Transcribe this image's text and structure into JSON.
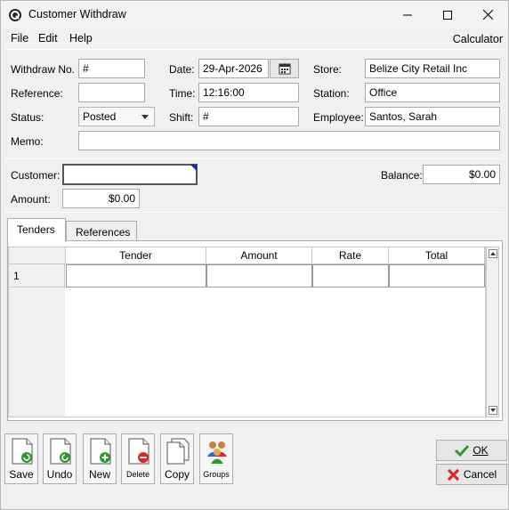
{
  "window": {
    "title": "Customer Withdraw"
  },
  "menu": {
    "file": "File",
    "edit": "Edit",
    "help": "Help",
    "calculator": "Calculator"
  },
  "header": {
    "withdraw_no_label": "Withdraw No.",
    "withdraw_no_value": "#",
    "reference_label": "Reference:",
    "reference_value": "",
    "status_label": "Status:",
    "status_value": "Posted",
    "memo_label": "Memo:",
    "memo_value": "",
    "date_label": "Date:",
    "date_value": "29-Apr-2026",
    "time_label": "Time:",
    "time_value": "12:16:00",
    "shift_label": "Shift:",
    "shift_value": "#",
    "store_label": "Store:",
    "store_value": "Belize City Retail Inc",
    "station_label": "Station:",
    "station_value": "Office",
    "employee_label": "Employee:",
    "employee_value": "Santos, Sarah"
  },
  "customer": {
    "customer_label": "Customer:",
    "customer_value": "",
    "amount_label": "Amount:",
    "amount_value": "$0.00",
    "balance_label": "Balance:",
    "balance_value": "$0.00"
  },
  "tabs": [
    {
      "label": "Tenders"
    },
    {
      "label": "References"
    }
  ],
  "grid": {
    "columns": [
      "Tender",
      "Amount",
      "Rate",
      "Total"
    ],
    "rows": [
      {
        "num": "1",
        "tender": "",
        "amount": "",
        "rate": "",
        "total": ""
      }
    ]
  },
  "toolbar": {
    "save": "Save",
    "undo": "Undo",
    "new": "New",
    "delete": "Delete",
    "copy": "Copy",
    "groups": "Groups"
  },
  "actions": {
    "ok": "OK",
    "cancel": "Cancel"
  },
  "colors": {
    "accent_blue": "#0a24d4",
    "ok_green": "#2e9a2e",
    "cancel_red": "#d62a2a"
  }
}
